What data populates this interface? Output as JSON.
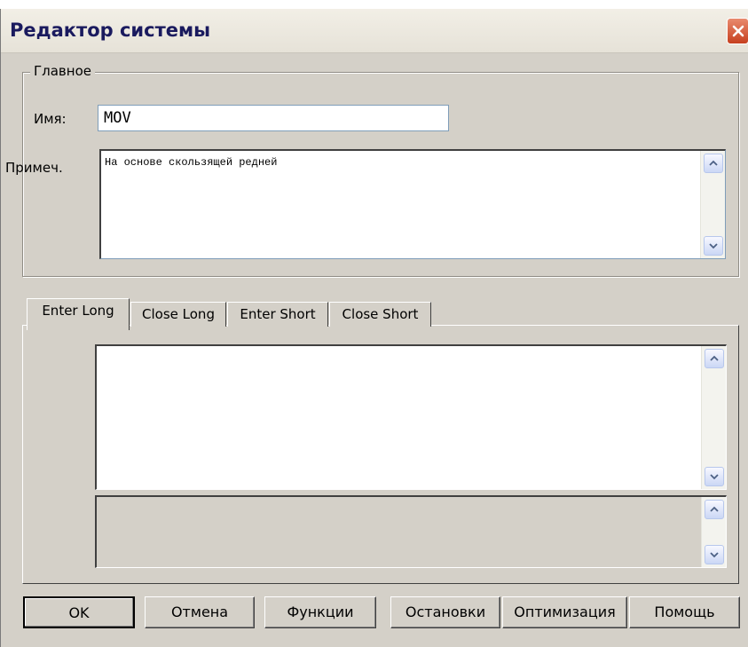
{
  "window": {
    "title": "Редактор системы"
  },
  "main_group": {
    "legend": "Главное",
    "name_label": "Имя:",
    "name_value": "MOV",
    "note_label": "Примеч.",
    "note_value": "На основе скользящей редней"
  },
  "tabs": [
    {
      "label": "Enter Long",
      "active": true
    },
    {
      "label": "Close Long",
      "active": false
    },
    {
      "label": "Enter Short",
      "active": false
    },
    {
      "label": "Close Short",
      "active": false
    }
  ],
  "buttons": {
    "ok": "OK",
    "cancel": "Отмена",
    "functions": "Функции",
    "stops": "Остановки",
    "optimization": "Оптимизация",
    "help": "Помощь"
  },
  "icons": {
    "close": "close-icon",
    "scroll_up": "scroll-up-icon",
    "scroll_down": "scroll-down-icon"
  },
  "colors": {
    "dialog_bg": "#d4d0c8",
    "close_button": "#c6401f",
    "title_text": "#1a1a5e"
  }
}
